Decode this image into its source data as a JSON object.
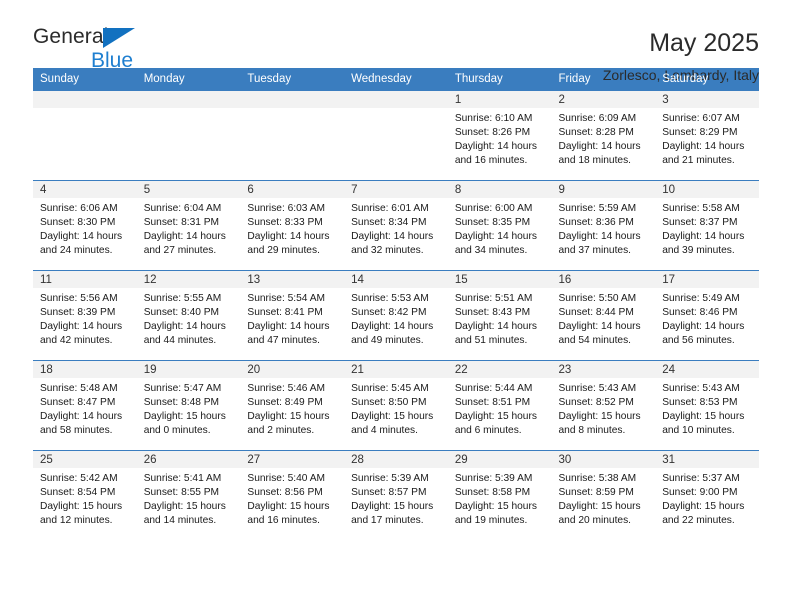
{
  "brand": {
    "name_top": "General",
    "name_bottom": "Blue",
    "triangle_color": "#1271c0",
    "blue_color": "#1f7fd0"
  },
  "header": {
    "title": "May 2025",
    "subtitle": "Zorlesco, Lombardy, Italy"
  },
  "theme": {
    "header_blue": "#3a7dbf",
    "daynum_bg": "#f2f2f2"
  },
  "weekdays": [
    "Sunday",
    "Monday",
    "Tuesday",
    "Wednesday",
    "Thursday",
    "Friday",
    "Saturday"
  ],
  "weeks": [
    [
      {
        "day": "",
        "lines": []
      },
      {
        "day": "",
        "lines": []
      },
      {
        "day": "",
        "lines": []
      },
      {
        "day": "",
        "lines": []
      },
      {
        "day": "1",
        "lines": [
          "Sunrise: 6:10 AM",
          "Sunset: 8:26 PM",
          "Daylight: 14 hours",
          "and 16 minutes."
        ]
      },
      {
        "day": "2",
        "lines": [
          "Sunrise: 6:09 AM",
          "Sunset: 8:28 PM",
          "Daylight: 14 hours",
          "and 18 minutes."
        ]
      },
      {
        "day": "3",
        "lines": [
          "Sunrise: 6:07 AM",
          "Sunset: 8:29 PM",
          "Daylight: 14 hours",
          "and 21 minutes."
        ]
      }
    ],
    [
      {
        "day": "4",
        "lines": [
          "Sunrise: 6:06 AM",
          "Sunset: 8:30 PM",
          "Daylight: 14 hours",
          "and 24 minutes."
        ]
      },
      {
        "day": "5",
        "lines": [
          "Sunrise: 6:04 AM",
          "Sunset: 8:31 PM",
          "Daylight: 14 hours",
          "and 27 minutes."
        ]
      },
      {
        "day": "6",
        "lines": [
          "Sunrise: 6:03 AM",
          "Sunset: 8:33 PM",
          "Daylight: 14 hours",
          "and 29 minutes."
        ]
      },
      {
        "day": "7",
        "lines": [
          "Sunrise: 6:01 AM",
          "Sunset: 8:34 PM",
          "Daylight: 14 hours",
          "and 32 minutes."
        ]
      },
      {
        "day": "8",
        "lines": [
          "Sunrise: 6:00 AM",
          "Sunset: 8:35 PM",
          "Daylight: 14 hours",
          "and 34 minutes."
        ]
      },
      {
        "day": "9",
        "lines": [
          "Sunrise: 5:59 AM",
          "Sunset: 8:36 PM",
          "Daylight: 14 hours",
          "and 37 minutes."
        ]
      },
      {
        "day": "10",
        "lines": [
          "Sunrise: 5:58 AM",
          "Sunset: 8:37 PM",
          "Daylight: 14 hours",
          "and 39 minutes."
        ]
      }
    ],
    [
      {
        "day": "11",
        "lines": [
          "Sunrise: 5:56 AM",
          "Sunset: 8:39 PM",
          "Daylight: 14 hours",
          "and 42 minutes."
        ]
      },
      {
        "day": "12",
        "lines": [
          "Sunrise: 5:55 AM",
          "Sunset: 8:40 PM",
          "Daylight: 14 hours",
          "and 44 minutes."
        ]
      },
      {
        "day": "13",
        "lines": [
          "Sunrise: 5:54 AM",
          "Sunset: 8:41 PM",
          "Daylight: 14 hours",
          "and 47 minutes."
        ]
      },
      {
        "day": "14",
        "lines": [
          "Sunrise: 5:53 AM",
          "Sunset: 8:42 PM",
          "Daylight: 14 hours",
          "and 49 minutes."
        ]
      },
      {
        "day": "15",
        "lines": [
          "Sunrise: 5:51 AM",
          "Sunset: 8:43 PM",
          "Daylight: 14 hours",
          "and 51 minutes."
        ]
      },
      {
        "day": "16",
        "lines": [
          "Sunrise: 5:50 AM",
          "Sunset: 8:44 PM",
          "Daylight: 14 hours",
          "and 54 minutes."
        ]
      },
      {
        "day": "17",
        "lines": [
          "Sunrise: 5:49 AM",
          "Sunset: 8:46 PM",
          "Daylight: 14 hours",
          "and 56 minutes."
        ]
      }
    ],
    [
      {
        "day": "18",
        "lines": [
          "Sunrise: 5:48 AM",
          "Sunset: 8:47 PM",
          "Daylight: 14 hours",
          "and 58 minutes."
        ]
      },
      {
        "day": "19",
        "lines": [
          "Sunrise: 5:47 AM",
          "Sunset: 8:48 PM",
          "Daylight: 15 hours",
          "and 0 minutes."
        ]
      },
      {
        "day": "20",
        "lines": [
          "Sunrise: 5:46 AM",
          "Sunset: 8:49 PM",
          "Daylight: 15 hours",
          "and 2 minutes."
        ]
      },
      {
        "day": "21",
        "lines": [
          "Sunrise: 5:45 AM",
          "Sunset: 8:50 PM",
          "Daylight: 15 hours",
          "and 4 minutes."
        ]
      },
      {
        "day": "22",
        "lines": [
          "Sunrise: 5:44 AM",
          "Sunset: 8:51 PM",
          "Daylight: 15 hours",
          "and 6 minutes."
        ]
      },
      {
        "day": "23",
        "lines": [
          "Sunrise: 5:43 AM",
          "Sunset: 8:52 PM",
          "Daylight: 15 hours",
          "and 8 minutes."
        ]
      },
      {
        "day": "24",
        "lines": [
          "Sunrise: 5:43 AM",
          "Sunset: 8:53 PM",
          "Daylight: 15 hours",
          "and 10 minutes."
        ]
      }
    ],
    [
      {
        "day": "25",
        "lines": [
          "Sunrise: 5:42 AM",
          "Sunset: 8:54 PM",
          "Daylight: 15 hours",
          "and 12 minutes."
        ]
      },
      {
        "day": "26",
        "lines": [
          "Sunrise: 5:41 AM",
          "Sunset: 8:55 PM",
          "Daylight: 15 hours",
          "and 14 minutes."
        ]
      },
      {
        "day": "27",
        "lines": [
          "Sunrise: 5:40 AM",
          "Sunset: 8:56 PM",
          "Daylight: 15 hours",
          "and 16 minutes."
        ]
      },
      {
        "day": "28",
        "lines": [
          "Sunrise: 5:39 AM",
          "Sunset: 8:57 PM",
          "Daylight: 15 hours",
          "and 17 minutes."
        ]
      },
      {
        "day": "29",
        "lines": [
          "Sunrise: 5:39 AM",
          "Sunset: 8:58 PM",
          "Daylight: 15 hours",
          "and 19 minutes."
        ]
      },
      {
        "day": "30",
        "lines": [
          "Sunrise: 5:38 AM",
          "Sunset: 8:59 PM",
          "Daylight: 15 hours",
          "and 20 minutes."
        ]
      },
      {
        "day": "31",
        "lines": [
          "Sunrise: 5:37 AM",
          "Sunset: 9:00 PM",
          "Daylight: 15 hours",
          "and 22 minutes."
        ]
      }
    ]
  ]
}
